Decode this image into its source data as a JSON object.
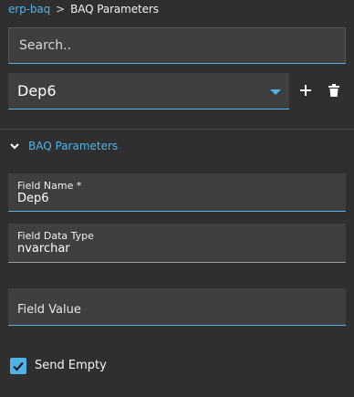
{
  "breadcrumb": {
    "parent": "erp-baq",
    "separator": ">",
    "current": "BAQ Parameters"
  },
  "search": {
    "placeholder": "Search.."
  },
  "selector": {
    "value": "Dep6"
  },
  "toolbar": {
    "add_icon": "plus-icon",
    "delete_icon": "trash-icon"
  },
  "section": {
    "title": "BAQ Parameters",
    "expanded": true
  },
  "fields": {
    "name": {
      "label": "Field Name *",
      "value": "Dep6"
    },
    "data_type": {
      "label": "Field Data Type",
      "value": "nvarchar"
    },
    "value": {
      "placeholder": "Field Value",
      "value": ""
    }
  },
  "send_empty": {
    "label": "Send Empty",
    "checked": true
  },
  "colors": {
    "accent": "#4fb3e8",
    "background": "#2f2f2f",
    "field_bg": "#3f3f3f"
  }
}
